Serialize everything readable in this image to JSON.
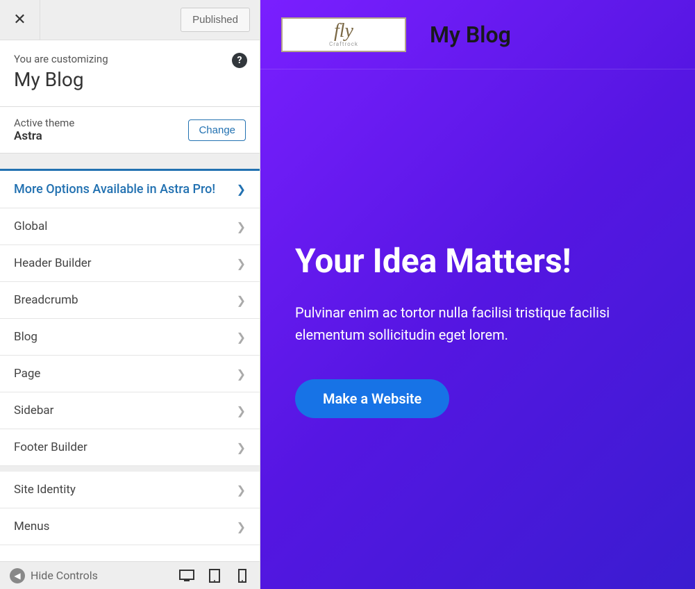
{
  "topbar": {
    "publish_label": "Published"
  },
  "header": {
    "customizing_label": "You are customizing",
    "site_name": "My Blog",
    "help_char": "?"
  },
  "theme": {
    "label": "Active theme",
    "name": "Astra",
    "change_label": "Change"
  },
  "promo": {
    "label": "More Options Available in Astra Pro!"
  },
  "sections": [
    {
      "label": "Global"
    },
    {
      "label": "Header Builder"
    },
    {
      "label": "Breadcrumb"
    },
    {
      "label": "Blog"
    },
    {
      "label": "Page"
    },
    {
      "label": "Sidebar"
    },
    {
      "label": "Footer Builder"
    },
    {
      "label": "Site Identity"
    },
    {
      "label": "Menus"
    }
  ],
  "bottom": {
    "hide_label": "Hide Controls"
  },
  "preview": {
    "logo_text": "fly",
    "logo_sub": "Craftrock",
    "blog_title": "My Blog",
    "hero_title": "Your Idea Matters!",
    "hero_text": "Pulvinar enim ac tortor nulla facilisi tristique facilisi elementum sollicitudin eget lorem.",
    "cta_label": "Make a Website"
  }
}
